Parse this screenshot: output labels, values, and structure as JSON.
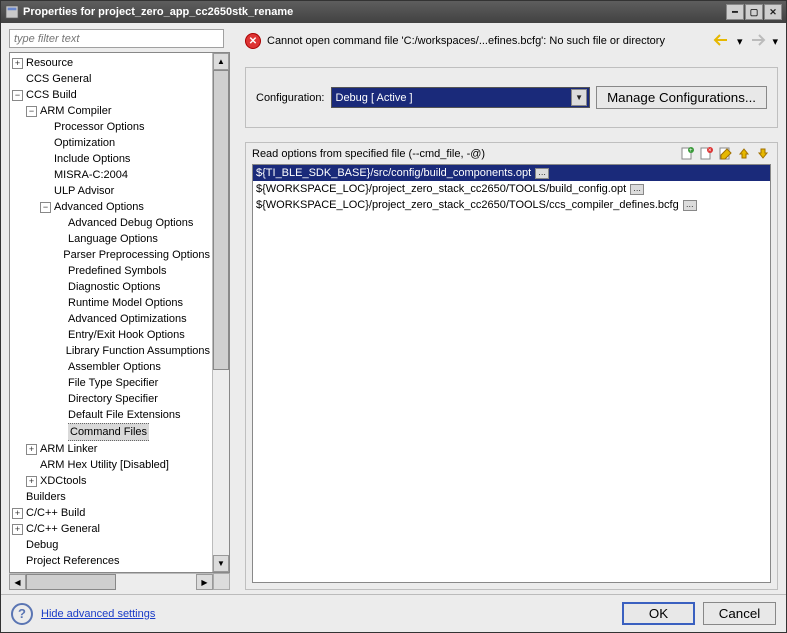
{
  "window": {
    "title": "Properties for project_zero_app_cc2650stk_rename"
  },
  "filter": {
    "placeholder": "type filter text"
  },
  "tree": {
    "resource": "Resource",
    "ccs_general": "CCS General",
    "ccs_build": "CCS Build",
    "arm_compiler": "ARM Compiler",
    "processor_options": "Processor Options",
    "optimization": "Optimization",
    "include_options": "Include Options",
    "misra": "MISRA-C:2004",
    "ulp": "ULP Advisor",
    "advanced_options": "Advanced Options",
    "adv_debug": "Advanced Debug Options",
    "lang_options": "Language Options",
    "parser": "Parser Preprocessing Options",
    "predef": "Predefined Symbols",
    "diag": "Diagnostic Options",
    "runtime": "Runtime Model Options",
    "adv_opt": "Advanced Optimizations",
    "entry_exit": "Entry/Exit Hook Options",
    "libfunc": "Library Function Assumptions",
    "asm": "Assembler Options",
    "file_type": "File Type Specifier",
    "dir_spec": "Directory Specifier",
    "default_ext": "Default File Extensions",
    "cmd_files": "Command Files",
    "arm_linker": "ARM Linker",
    "arm_hex": "ARM Hex Utility  [Disabled]",
    "xdctools": "XDCtools",
    "builders": "Builders",
    "cpp_build": "C/C++ Build",
    "cpp_general": "C/C++ General",
    "debug": "Debug",
    "proj_refs": "Project References"
  },
  "error": {
    "text": "Cannot open command file 'C:/workspaces/...efines.bcfg': No such file or directory"
  },
  "config": {
    "label": "Configuration:",
    "value": "Debug  [ Active ]",
    "manage": "Manage Configurations..."
  },
  "list": {
    "label": "Read options from specified file (--cmd_file, -@)",
    "items": [
      "${TI_BLE_SDK_BASE}/src/config/build_components.opt",
      "${WORKSPACE_LOC}/project_zero_stack_cc2650/TOOLS/build_config.opt",
      "${WORKSPACE_LOC}/project_zero_stack_cc2650/TOOLS/ccs_compiler_defines.bcfg"
    ]
  },
  "footer": {
    "link": "Hide advanced settings",
    "ok": "OK",
    "cancel": "Cancel"
  }
}
